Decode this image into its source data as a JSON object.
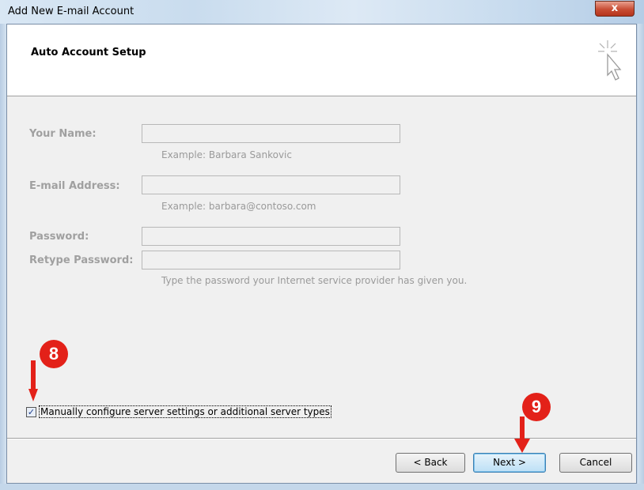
{
  "window": {
    "title": "Add New E-mail Account",
    "close_glyph": "x"
  },
  "header": {
    "title": "Auto Account Setup",
    "icon": "cursor-sparkle-icon"
  },
  "form": {
    "name": {
      "label": "Your Name:",
      "value": "",
      "hint": "Example: Barbara Sankovic"
    },
    "email": {
      "label": "E-mail Address:",
      "value": "",
      "hint": "Example: barbara@contoso.com"
    },
    "password": {
      "label": "Password:",
      "value": ""
    },
    "retype": {
      "label": "Retype Password:",
      "value": "",
      "hint": "Type the password your Internet service provider has given you."
    }
  },
  "manual_config": {
    "label": "Manually configure server settings or additional server types",
    "checked": true,
    "check_glyph": "✓"
  },
  "buttons": {
    "back": "< Back",
    "next": "Next >",
    "cancel": "Cancel"
  },
  "annotations": {
    "step8": "8",
    "step9": "9",
    "color": "#e32119"
  }
}
